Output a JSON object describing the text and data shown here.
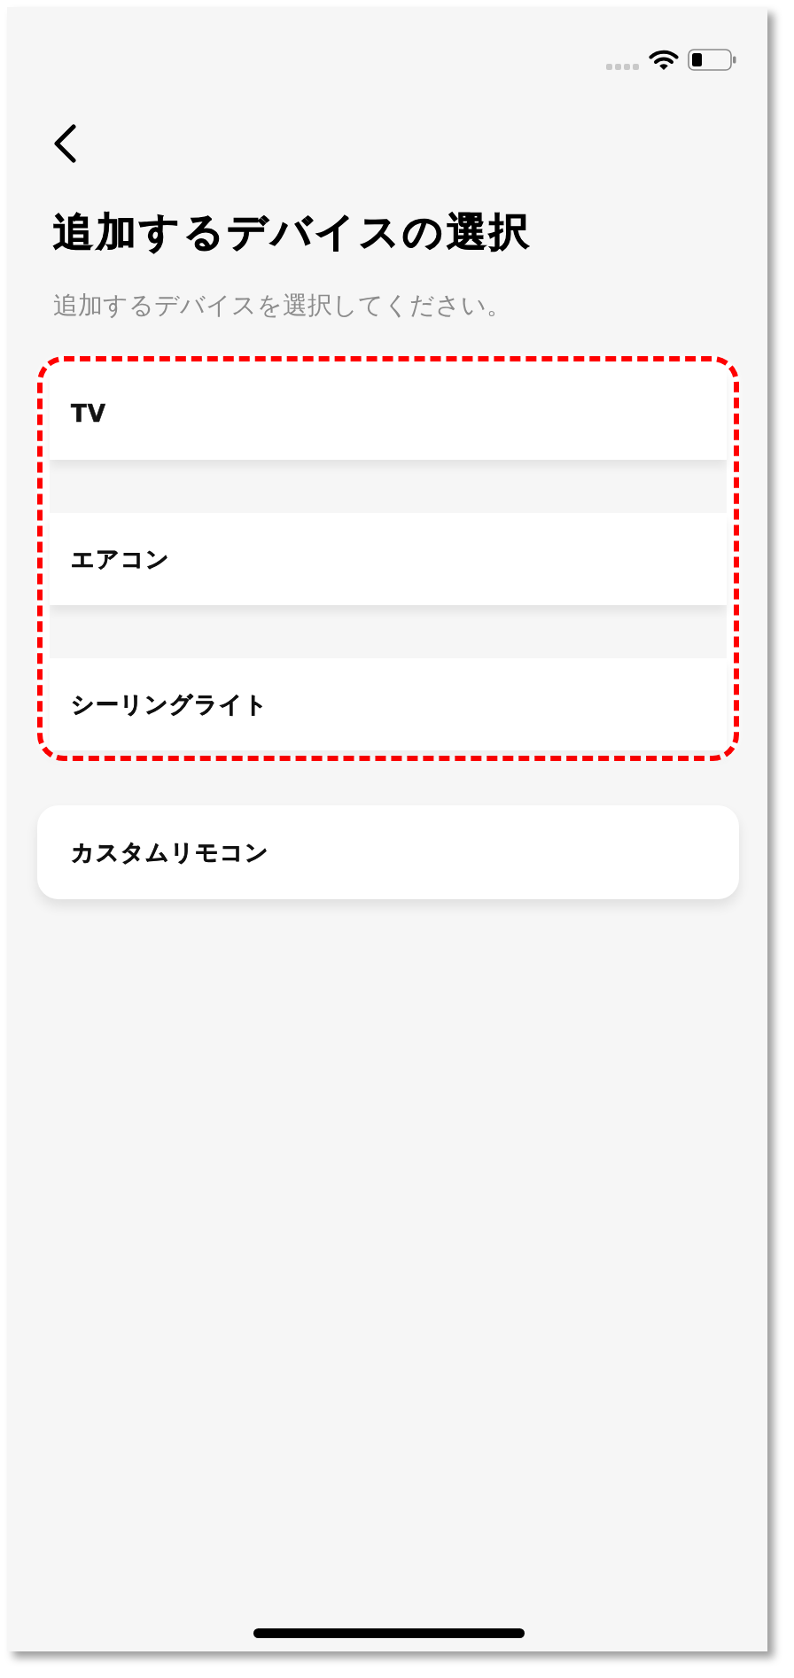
{
  "header": {
    "title": "追加するデバイスの選択",
    "subtitle": "追加するデバイスを選択してください。"
  },
  "device_groups": [
    {
      "highlighted": true,
      "items": [
        {
          "label": "TV"
        },
        {
          "label": "エアコン"
        },
        {
          "label": "シーリングライト"
        }
      ]
    },
    {
      "highlighted": false,
      "items": [
        {
          "label": "カスタムリモコン"
        }
      ]
    }
  ]
}
